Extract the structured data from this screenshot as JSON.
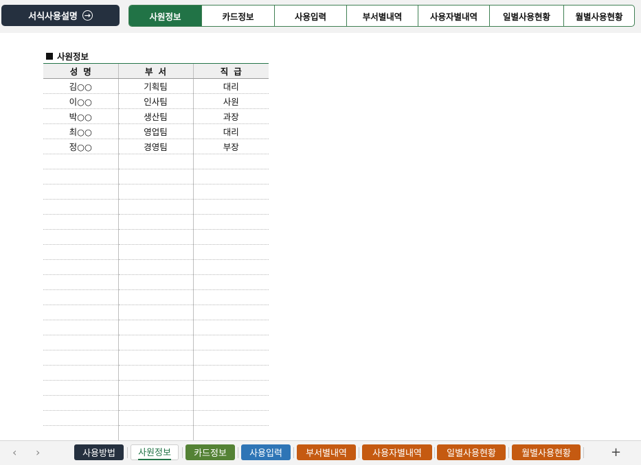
{
  "header": {
    "guide_button": "서식사용설명",
    "guide_icon": "→",
    "tabs": [
      "사원정보",
      "카드정보",
      "사용입력",
      "부서별내역",
      "사용자별내역",
      "일별사용현황",
      "월별사용현황"
    ],
    "active_tab": "사원정보",
    "accent_color": "#217346"
  },
  "sheet": {
    "title": "사원정보",
    "columns": [
      "성명",
      "부서",
      "직급"
    ],
    "rows": [
      [
        "김○○",
        "기획팀",
        "대리"
      ],
      [
        "이○○",
        "인사팀",
        "사원"
      ],
      [
        "박○○",
        "생산팀",
        "과장"
      ],
      [
        "최○○",
        "영업팀",
        "대리"
      ],
      [
        "정○○",
        "경영팀",
        "부장"
      ]
    ]
  },
  "sheet_tabs": [
    {
      "label": "사용방법",
      "color": "#25303f"
    },
    {
      "label": "사원정보",
      "color": "#ffffff"
    },
    {
      "label": "카드정보",
      "color": "#548235"
    },
    {
      "label": "사용입력",
      "color": "#2e75b6"
    },
    {
      "label": "부서별내역",
      "color": "#c55a11"
    },
    {
      "label": "사용자별내역",
      "color": "#c55a11"
    },
    {
      "label": "일별사용현황",
      "color": "#c55a11"
    },
    {
      "label": "월별사용현황",
      "color": "#c55a11"
    }
  ],
  "add_sheet_label": "+"
}
